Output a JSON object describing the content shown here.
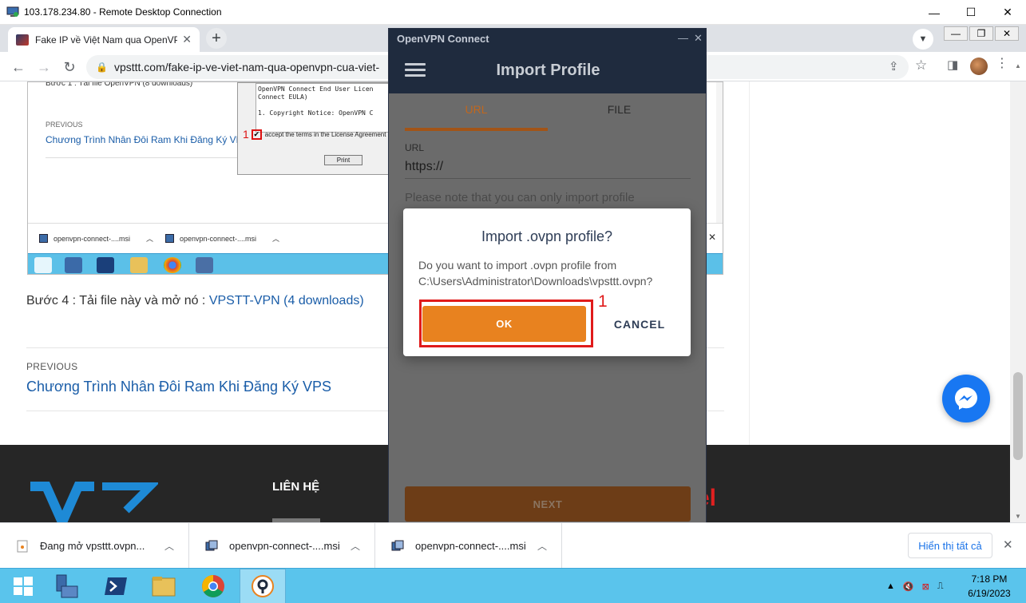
{
  "rdp": {
    "title": "103.178.234.80 - Remote Desktop Connection",
    "minimize": "—",
    "maximize": "☐",
    "close": "✕"
  },
  "browser": {
    "tab_title": "Fake IP về Việt Nam qua OpenVPN",
    "tab_close": "✕",
    "new_tab": "+",
    "url": "vpsttt.com/fake-ip-ve-viet-nam-qua-openvpn-cua-viet-",
    "inner_min": "—",
    "inner_restore": "❐",
    "inner_close": "✕"
  },
  "embedded": {
    "step_text": "Bước 1 : Tải file OpenVPN (8 downloads)",
    "prev_label": "PREVIOUS",
    "prev_link": "Chương Trình Nhân Đôi Ram Khi Đăng Ký VPS",
    "eula_lines": [
      "OpenVPN Connect End User Licen",
      "Connect EULA)",
      "",
      "1. Copyright Notice: OpenVPN C"
    ],
    "checkbox_number": "1",
    "checkbox_label": "accept the terms in the License Agreement",
    "print_button": "Print",
    "downloads": [
      "openvpn-connect-....msi",
      "openvpn-connect-....msi"
    ],
    "close_x": "✕"
  },
  "article": {
    "step4_prefix": "Bước 4 : Tải file này và mở nó : ",
    "step4_link": "VPSTT-VPN (4 downloads)",
    "prev_label": "PREVIOUS",
    "prev_link": "Chương Trình Nhân Đôi Ram Khi Đăng Ký VPS"
  },
  "footer": {
    "lienhe": "LIÊN HỆ",
    "red_text": "el"
  },
  "openvpn": {
    "window_title": "OpenVPN Connect",
    "heading": "Import Profile",
    "tab_url": "URL",
    "tab_file": "FILE",
    "url_label": "URL",
    "url_value": "https://",
    "note": "Please note that you can only import profile",
    "next_button": "NEXT"
  },
  "dialog": {
    "title": "Import .ovpn profile?",
    "body_line1": "Do you want to import .ovpn profile from",
    "body_line2": "C:\\Users\\Administrator\\Downloads\\vpsttt.ovpn?",
    "ok_button": "OK",
    "cancel_button": "CANCEL",
    "annotation_number": "1"
  },
  "download_shelf": {
    "items": [
      "Đang mở vpsttt.ovpn...",
      "openvpn-connect-....msi",
      "openvpn-connect-....msi"
    ],
    "show_all": "Hiển thị tất cả",
    "close": "✕"
  },
  "taskbar": {
    "time": "7:18 PM",
    "date": "6/19/2023"
  },
  "colors": {
    "accent_orange": "#e8821f",
    "annotation_red": "#e01b1b",
    "ovpn_navy": "#1f2b3e",
    "taskbar_blue": "#5ac4ec"
  }
}
